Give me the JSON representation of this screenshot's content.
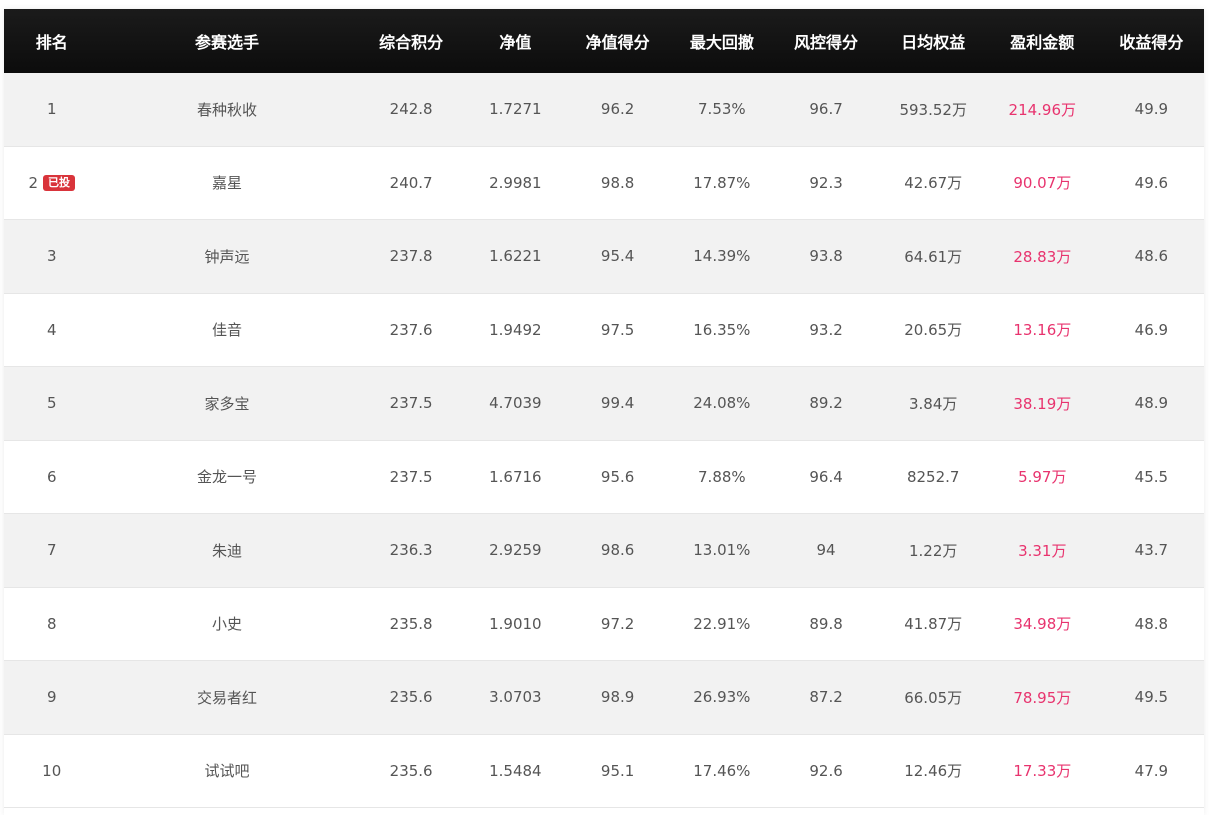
{
  "table": {
    "headers": {
      "rank": "排名",
      "player": "参赛选手",
      "composite_score": "综合积分",
      "nav": "净值",
      "nav_score": "净值得分",
      "max_drawdown": "最大回撤",
      "risk_score": "风控得分",
      "daily_equity": "日均权益",
      "profit": "盈利金额",
      "return_score": "收益得分"
    },
    "rows": [
      {
        "rank": "1",
        "badge": "",
        "player": "春种秋收",
        "composite_score": "242.8",
        "nav": "1.7271",
        "nav_score": "96.2",
        "max_drawdown": "7.53%",
        "risk_score": "96.7",
        "daily_equity": "593.52万",
        "profit": "214.96万",
        "return_score": "49.9"
      },
      {
        "rank": "2",
        "badge": "已投",
        "player": "嘉星",
        "composite_score": "240.7",
        "nav": "2.9981",
        "nav_score": "98.8",
        "max_drawdown": "17.87%",
        "risk_score": "92.3",
        "daily_equity": "42.67万",
        "profit": "90.07万",
        "return_score": "49.6"
      },
      {
        "rank": "3",
        "badge": "",
        "player": "钟声远",
        "composite_score": "237.8",
        "nav": "1.6221",
        "nav_score": "95.4",
        "max_drawdown": "14.39%",
        "risk_score": "93.8",
        "daily_equity": "64.61万",
        "profit": "28.83万",
        "return_score": "48.6"
      },
      {
        "rank": "4",
        "badge": "",
        "player": "佳音",
        "composite_score": "237.6",
        "nav": "1.9492",
        "nav_score": "97.5",
        "max_drawdown": "16.35%",
        "risk_score": "93.2",
        "daily_equity": "20.65万",
        "profit": "13.16万",
        "return_score": "46.9"
      },
      {
        "rank": "5",
        "badge": "",
        "player": "家多宝",
        "composite_score": "237.5",
        "nav": "4.7039",
        "nav_score": "99.4",
        "max_drawdown": "24.08%",
        "risk_score": "89.2",
        "daily_equity": "3.84万",
        "profit": "38.19万",
        "return_score": "48.9"
      },
      {
        "rank": "6",
        "badge": "",
        "player": "金龙一号",
        "composite_score": "237.5",
        "nav": "1.6716",
        "nav_score": "95.6",
        "max_drawdown": "7.88%",
        "risk_score": "96.4",
        "daily_equity": "8252.7",
        "profit": "5.97万",
        "return_score": "45.5"
      },
      {
        "rank": "7",
        "badge": "",
        "player": "朱迪",
        "composite_score": "236.3",
        "nav": "2.9259",
        "nav_score": "98.6",
        "max_drawdown": "13.01%",
        "risk_score": "94",
        "daily_equity": "1.22万",
        "profit": "3.31万",
        "return_score": "43.7"
      },
      {
        "rank": "8",
        "badge": "",
        "player": "小史",
        "composite_score": "235.8",
        "nav": "1.9010",
        "nav_score": "97.2",
        "max_drawdown": "22.91%",
        "risk_score": "89.8",
        "daily_equity": "41.87万",
        "profit": "34.98万",
        "return_score": "48.8"
      },
      {
        "rank": "9",
        "badge": "",
        "player": "交易者红",
        "composite_score": "235.6",
        "nav": "3.0703",
        "nav_score": "98.9",
        "max_drawdown": "26.93%",
        "risk_score": "87.2",
        "daily_equity": "66.05万",
        "profit": "78.95万",
        "return_score": "49.5"
      },
      {
        "rank": "10",
        "badge": "",
        "player": "试试吧",
        "composite_score": "235.6",
        "nav": "1.5484",
        "nav_score": "95.1",
        "max_drawdown": "17.46%",
        "risk_score": "92.6",
        "daily_equity": "12.46万",
        "profit": "17.33万",
        "return_score": "47.9"
      }
    ]
  },
  "colors": {
    "header_bg": "#111111",
    "row_alt_bg": "#f2f2f2",
    "profit_text": "#e8336e",
    "badge_bg": "#d9343b"
  }
}
